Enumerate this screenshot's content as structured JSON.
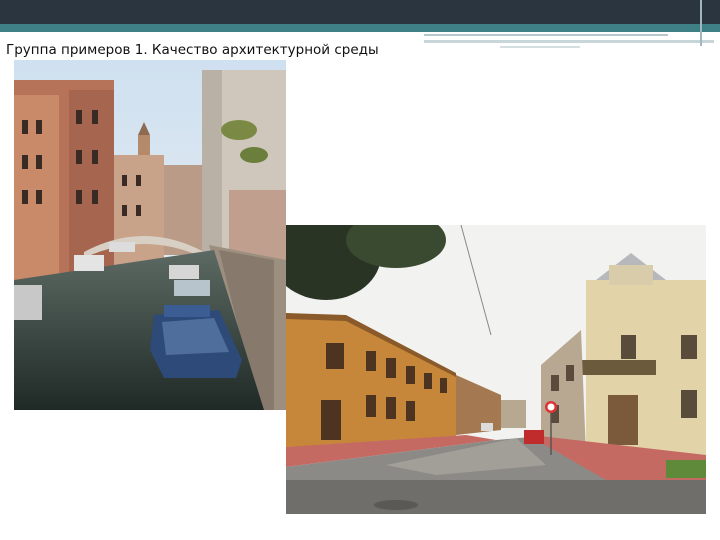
{
  "slide": {
    "title": "Группа примеров 1. Качество архитектурной среды"
  },
  "images": {
    "photo1": {
      "alt": "Venetian canal with boats between old buildings"
    },
    "photo2": {
      "alt": "Street with wooden houses and paved road"
    }
  },
  "colors": {
    "header_bar": "#2b3540",
    "accent_bar": "#3f7f86"
  }
}
